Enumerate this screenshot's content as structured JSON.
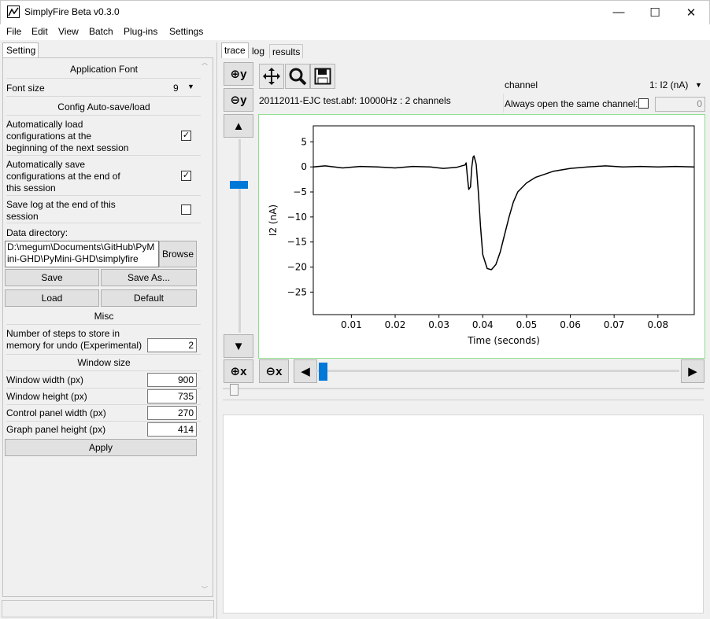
{
  "window": {
    "title": "SimplyFire Beta v0.3.0",
    "minimize": "—",
    "maximize": "☐",
    "close": "✕"
  },
  "menu": [
    "File",
    "Edit",
    "View",
    "Batch",
    "Plug-ins",
    "Settings"
  ],
  "left_tab": "Setting",
  "settings": {
    "app_font_header": "Application Font",
    "font_size_label": "Font size",
    "font_size_value": "9",
    "autosave_header": "Config Auto-save/load",
    "auto_load_label": [
      "Automatically load",
      "configurations at the",
      "beginning of the next session"
    ],
    "auto_load_checked": true,
    "auto_save_label": [
      "Automatically save",
      "configurations at the end of",
      "this session"
    ],
    "auto_save_checked": true,
    "save_log_label": [
      "Save log at the end of this",
      "session"
    ],
    "save_log_checked": false,
    "data_dir_label": "Data directory:",
    "data_dir_value": [
      "D:\\megum\\Documents\\GitHub\\PyM",
      "ini-GHD\\PyMini-GHD\\simplyfire"
    ],
    "browse": "Browse",
    "save": "Save",
    "save_as": "Save As...",
    "load": "Load",
    "default": "Default",
    "misc_header": "Misc",
    "undo_label": [
      "Number of steps to store in",
      "memory for undo (Experimental)"
    ],
    "undo_value": "2",
    "window_size_header": "Window size",
    "window_width_label": "Window width (px)",
    "window_width_value": "900",
    "window_height_label": "Window height (px)",
    "window_height_value": "735",
    "control_width_label": "Control panel width (px)",
    "control_width_value": "270",
    "graph_height_label": "Graph panel height (px)",
    "graph_height_value": "414",
    "apply": "Apply"
  },
  "right_tabs": [
    "trace",
    "log",
    "results"
  ],
  "file_info": "20112011-EJC test.abf: 10000Hz : 2 channels",
  "channel": {
    "label": "channel",
    "value": "1: I2 (nA)",
    "always_open_label": "Always open the same channel:",
    "always_open_checked": false,
    "channel_index": "0"
  },
  "toolbar": {
    "zoom_in_y": "⊕y",
    "zoom_out_y": "⊖y",
    "zoom_in_x": "⊕x",
    "zoom_out_x": "⊖x",
    "up": "▲",
    "down": "▼",
    "left": "◀",
    "right": "▶"
  },
  "colors": {
    "accent": "#0078d7",
    "plot_border": "#8ee08e",
    "trace": "#000000"
  },
  "chart_data": {
    "type": "line",
    "xlabel": "Time (seconds)",
    "ylabel": "I2 (nA)",
    "xlim": [
      0.0013,
      0.0883
    ],
    "ylim": [
      -29.5,
      8.2
    ],
    "xticks": [
      0.01,
      0.02,
      0.03,
      0.04,
      0.05,
      0.06,
      0.07,
      0.08
    ],
    "xtick_labels": [
      "0.01",
      "0.02",
      "0.03",
      "0.04",
      "0.05",
      "0.06",
      "0.07",
      "0.08"
    ],
    "yticks": [
      5,
      0,
      -5,
      -10,
      -15,
      -20,
      -25
    ],
    "ytick_labels": [
      "5",
      "0",
      "−5",
      "−10",
      "−15",
      "−20",
      "−25"
    ],
    "grid": false,
    "series": [
      {
        "x": [
          0.0013,
          0.004,
          0.008,
          0.012,
          0.016,
          0.02,
          0.024,
          0.028,
          0.031,
          0.034,
          0.036,
          0.0362,
          0.0365,
          0.0368,
          0.0372,
          0.0375,
          0.0378,
          0.038,
          0.0385,
          0.039,
          0.0395,
          0.04,
          0.041,
          0.0418,
          0.042,
          0.043,
          0.044,
          0.045,
          0.046,
          0.047,
          0.048,
          0.05,
          0.052,
          0.054,
          0.056,
          0.058,
          0.06,
          0.064,
          0.068,
          0.072,
          0.076,
          0.08,
          0.084,
          0.0883
        ],
        "y": [
          0.0,
          0.2,
          -0.2,
          0.1,
          0.0,
          -0.2,
          0.1,
          0.0,
          -0.3,
          -0.1,
          0.4,
          0.8,
          -2.0,
          -4.5,
          -4.0,
          0.0,
          2.0,
          2.2,
          0.5,
          -5.0,
          -12.0,
          -17.5,
          -20.3,
          -20.5,
          -20.5,
          -19.5,
          -17.0,
          -13.5,
          -10.0,
          -7.0,
          -5.0,
          -3.2,
          -2.1,
          -1.5,
          -0.9,
          -0.6,
          -0.3,
          0.0,
          0.2,
          0.0,
          0.1,
          0.0,
          0.1,
          0.0
        ]
      }
    ]
  }
}
